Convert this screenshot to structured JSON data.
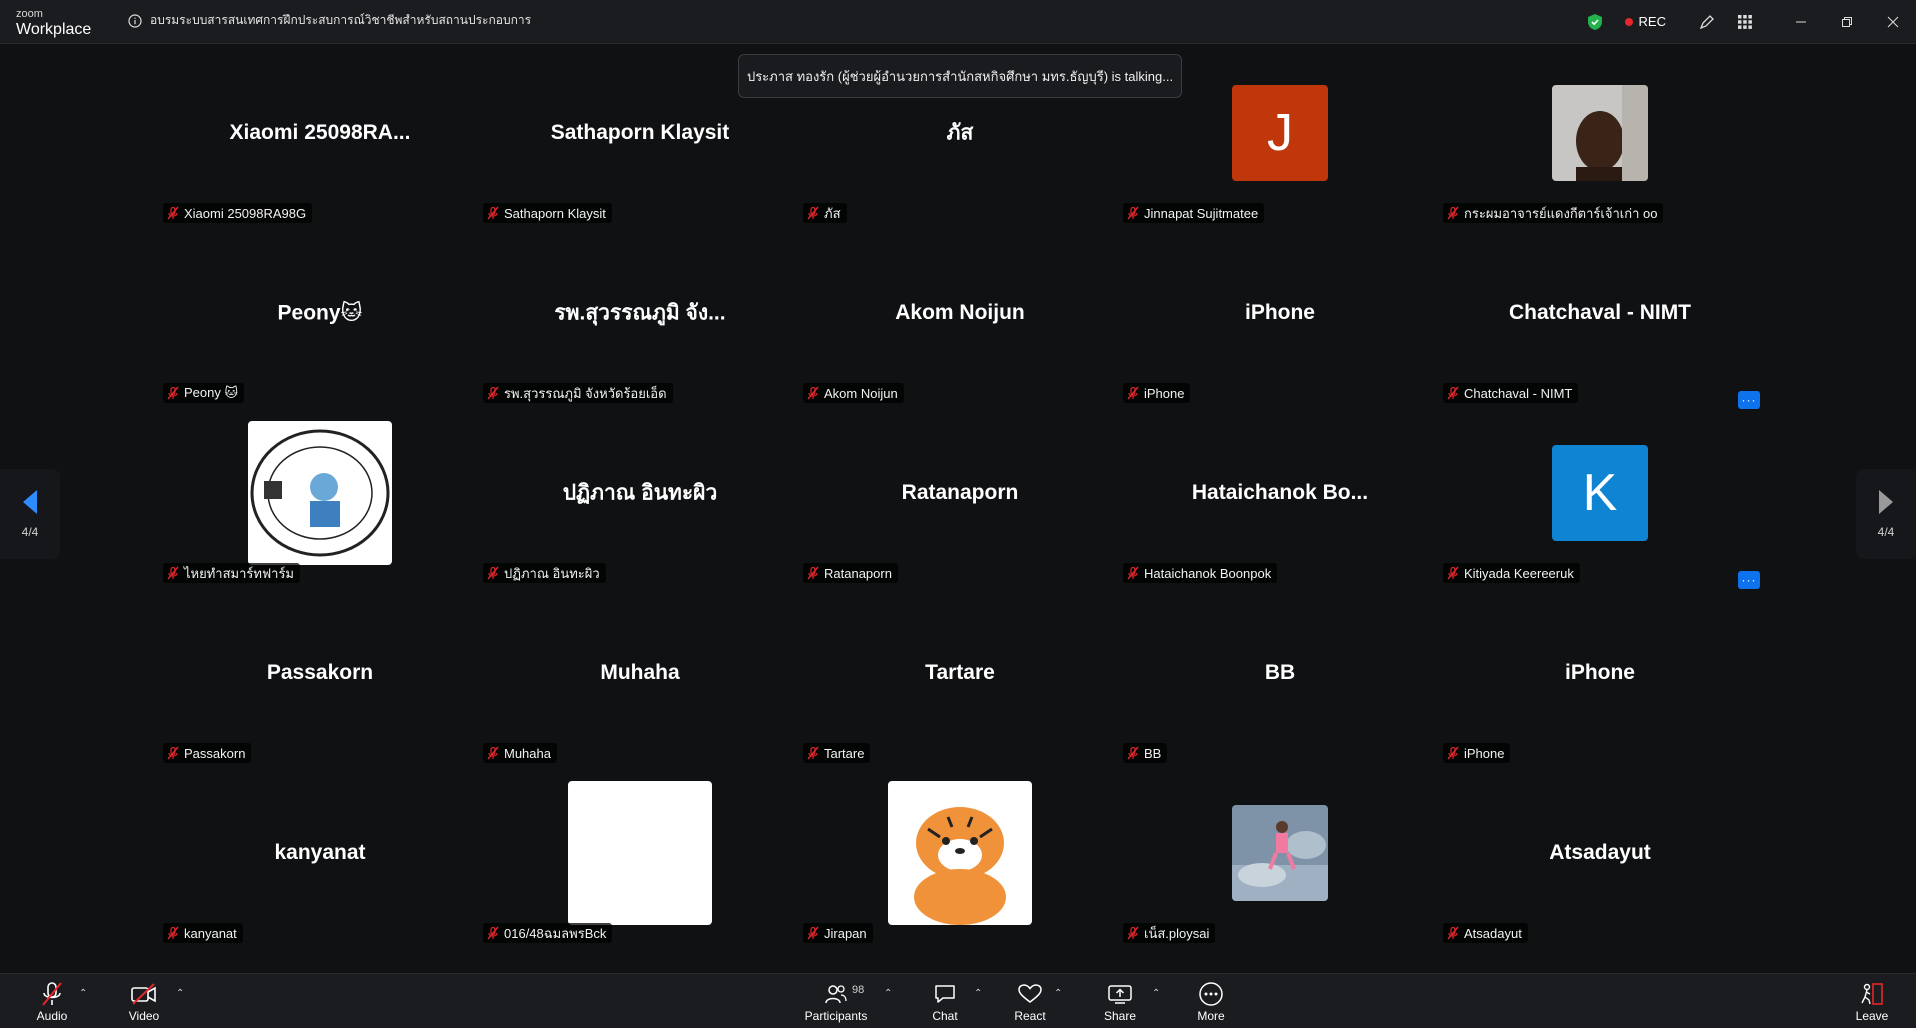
{
  "app": {
    "logo_small": "zoom",
    "logo_big": "Workplace"
  },
  "meeting": {
    "title": "อบรมระบบสารสนเทศการฝึกประสบการณ์วิชาชีพสำหรับสถานประกอบการ",
    "rec_label": "REC"
  },
  "talking_banner": "ประภาส ทองรัก (ผู้ช่วยผู้อำนวยการสำนักสหกิจศึกษา มทร.ธัญบุรี) is talking...",
  "pager": {
    "left_count": "4/4",
    "right_count": "4/4"
  },
  "tiles": [
    {
      "display": "Xiaomi  25098RA...",
      "label": "Xiaomi 25098RA98G"
    },
    {
      "display": "Sathaporn Klaysit",
      "label": "Sathaporn Klaysit"
    },
    {
      "display": "ภัส",
      "label": "ภัส"
    },
    {
      "display": "",
      "avatar_letter": "J",
      "avatar_color": "#c0370b",
      "label": "Jinnapat Sujitmatee"
    },
    {
      "display": "",
      "avatar_type": "photo-person",
      "label": "กระผมอาจารย์แดงกีตาร์เจ้าเก่า oo"
    },
    {
      "display": "Peony🐱",
      "label": "Peony 🐱"
    },
    {
      "display": "รพ.สุวรรณภูมิ จัง...",
      "label": "รพ.สุวรรณภูมิ จังหวัดร้อยเอ็ด"
    },
    {
      "display": "Akom Noijun",
      "label": "Akom Noijun"
    },
    {
      "display": "iPhone",
      "label": "iPhone"
    },
    {
      "display": "Chatchaval - NIMT",
      "label": "Chatchaval - NIMT"
    },
    {
      "display": "",
      "avatar_type": "logo-farm",
      "label": "ไหยทำสมาร์ทฟาร์ม"
    },
    {
      "display": "ปฏิภาณ อินทะผิว",
      "label": "ปฏิภาณ อินทะผิว"
    },
    {
      "display": "Ratanaporn",
      "label": "Ratanaporn"
    },
    {
      "display": "Hataichanok  Bo...",
      "label": "Hataichanok Boonpok"
    },
    {
      "display": "",
      "avatar_letter": "K",
      "avatar_color": "#0e84d2",
      "label": "Kitiyada Keereeruk",
      "more": "···"
    },
    {
      "display": "Passakorn",
      "label": "Passakorn"
    },
    {
      "display": "Muhaha",
      "label": "Muhaha"
    },
    {
      "display": "Tartare",
      "label": "Tartare"
    },
    {
      "display": "BB",
      "label": "BB"
    },
    {
      "display": "iPhone",
      "label": "iPhone",
      "more": "···"
    },
    {
      "display": "kanyanat",
      "label": "kanyanat"
    },
    {
      "display": "",
      "avatar_type": "white",
      "label": "016/48ฉมลพรBck"
    },
    {
      "display": "",
      "avatar_type": "tiger",
      "label": "Jirapan"
    },
    {
      "display": "",
      "avatar_type": "photo-girl",
      "label": "เน็ส.ploysai"
    },
    {
      "display": "Atsadayut",
      "label": "Atsadayut"
    }
  ],
  "toolbar": {
    "audio": "Audio",
    "video": "Video",
    "participants": "Participants",
    "participants_count": "98",
    "chat": "Chat",
    "react": "React",
    "share": "Share",
    "more": "More",
    "leave": "Leave"
  },
  "colors": {
    "background": "#0f1113",
    "bar": "#1b1c1f",
    "accent": "#0e72ed",
    "muted": "#e5262b"
  }
}
